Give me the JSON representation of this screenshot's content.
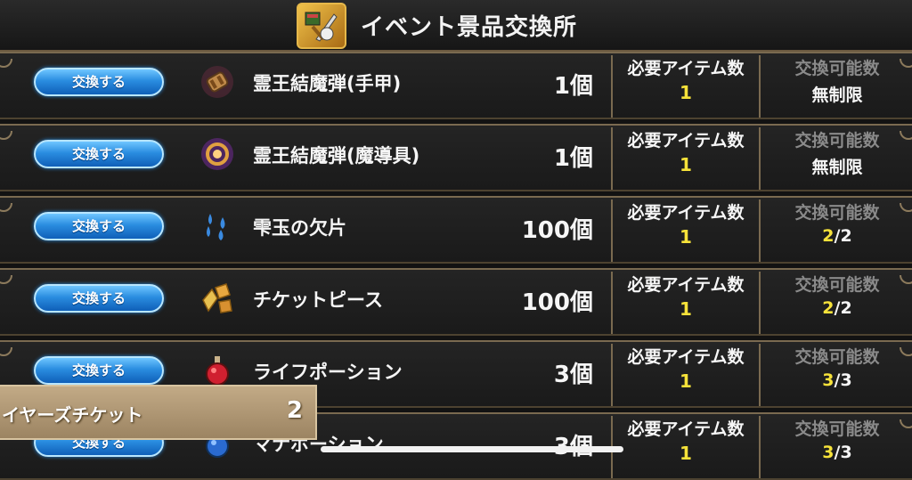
{
  "header": {
    "title": "イベント景品交換所",
    "icon": "swords-shop-icon"
  },
  "button_label": "交換する",
  "required_label": "必要アイテム数",
  "available_label": "交換可能数",
  "rows": [
    {
      "name": "霊王結魔弾(手甲)",
      "qty": "1個",
      "required": "1",
      "avail_unlimited": "無制限",
      "icon": "gauntlet-icon"
    },
    {
      "name": "霊王結魔弾(魔導具)",
      "qty": "1個",
      "required": "1",
      "avail_unlimited": "無制限",
      "icon": "magic-tool-icon"
    },
    {
      "name": "雫玉の欠片",
      "qty": "100個",
      "required": "1",
      "avail_current": "2",
      "avail_total": "/2",
      "icon": "droplet-shards-icon"
    },
    {
      "name": "チケットピース",
      "qty": "100個",
      "required": "1",
      "avail_current": "2",
      "avail_total": "/2",
      "icon": "ticket-pieces-icon"
    },
    {
      "name": "ライフポーション",
      "qty": "3個",
      "required": "1",
      "avail_current": "3",
      "avail_total": "/3",
      "icon": "life-potion-icon"
    },
    {
      "name": "マナポーション",
      "qty": "3個",
      "required": "1",
      "avail_current": "3",
      "avail_total": "/3",
      "icon": "mana-potion-icon"
    }
  ],
  "ticket": {
    "label": "イヤーズチケット",
    "count": "2"
  },
  "colors": {
    "button": "#2a8de0",
    "highlight": "#f6e23a",
    "frame": "#7a6a50"
  }
}
